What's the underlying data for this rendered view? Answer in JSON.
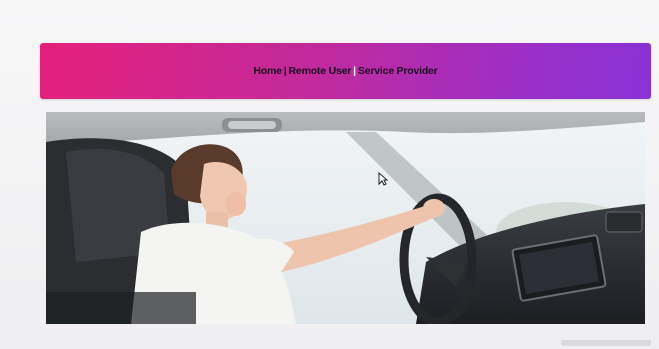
{
  "nav": {
    "home": "Home",
    "remote_user": "Remote User",
    "service_provider": "Service Provider",
    "separator": "|"
  },
  "hero": {
    "subject": "woman yawning while driving a car"
  },
  "colors": {
    "banner_start": "#e4207a",
    "banner_end": "#8a33d6",
    "nav_text": "#1a0a1e"
  }
}
